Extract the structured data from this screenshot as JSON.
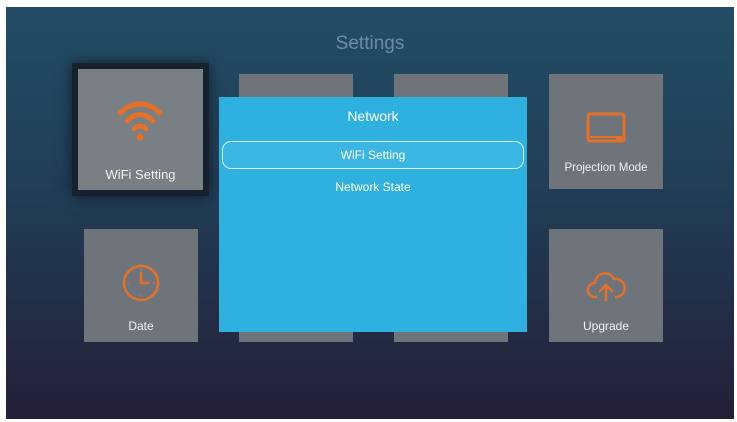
{
  "screen": {
    "title": "Settings"
  },
  "tiles": [
    {
      "label": "WiFi Setting",
      "icon": "wifi-icon",
      "selected": true
    },
    {
      "label": "",
      "icon": "none"
    },
    {
      "label": "",
      "icon": "none"
    },
    {
      "label": "Projection Mode",
      "icon": "monitor-icon"
    },
    {
      "label": "Date",
      "icon": "clock-icon"
    },
    {
      "label": "",
      "icon": "none"
    },
    {
      "label": "",
      "icon": "none"
    },
    {
      "label": "Upgrade",
      "icon": "cloud-upload-icon"
    }
  ],
  "dialog": {
    "title": "Network",
    "options": [
      {
        "label": "WiFi Setting",
        "focused": true
      },
      {
        "label": "Network State",
        "focused": false
      }
    ]
  },
  "colors": {
    "accent": "#e4702a",
    "dialog_bg": "#2fb1e0",
    "tile_bg": "#6e747a"
  }
}
